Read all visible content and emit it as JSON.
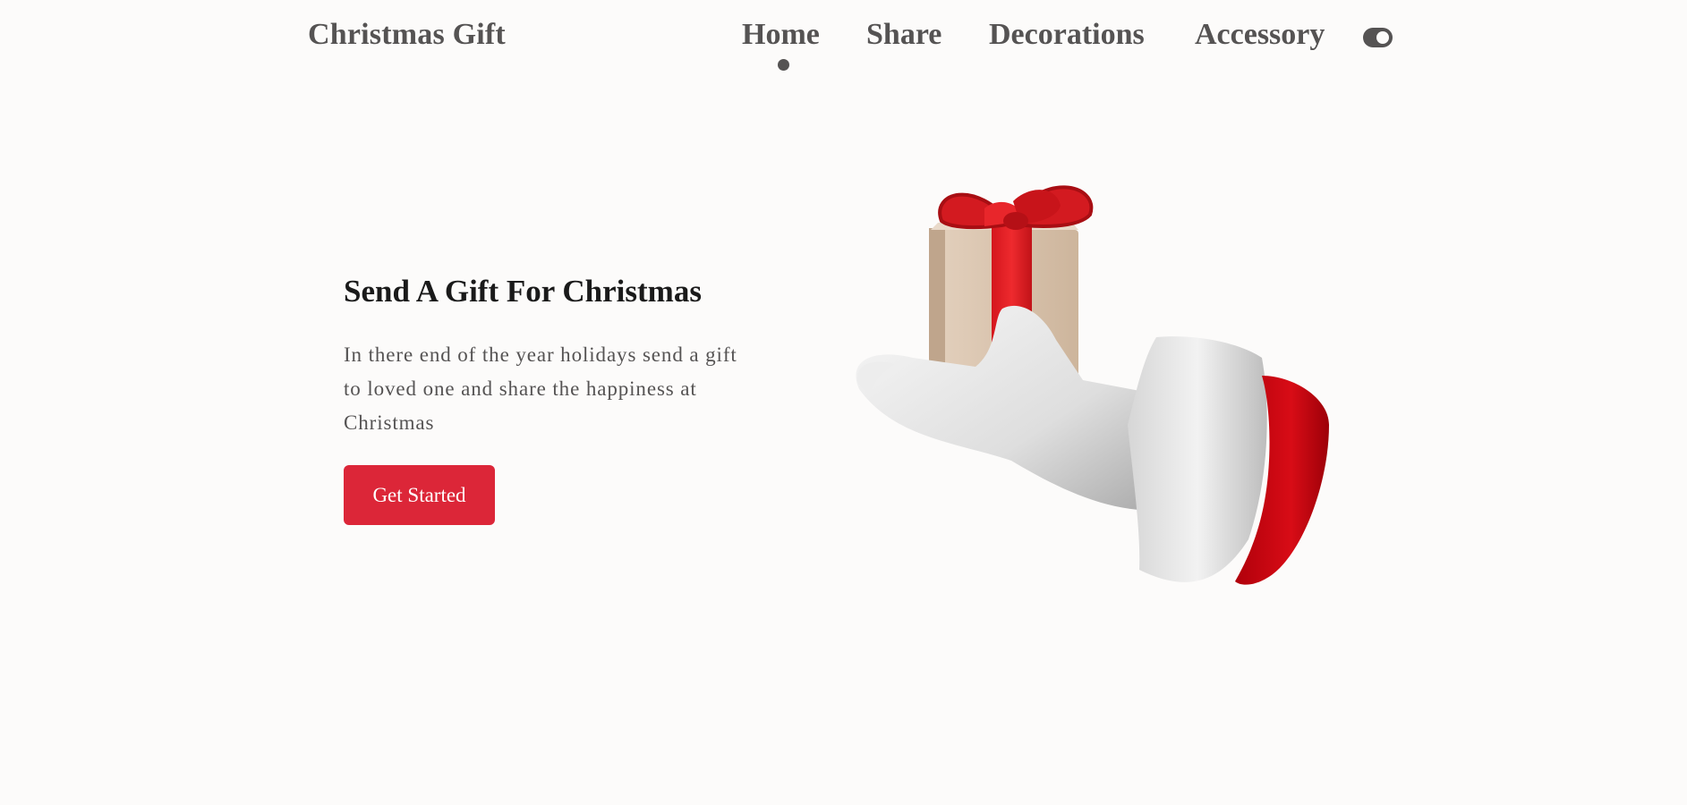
{
  "header": {
    "brand": "Christmas Gift",
    "nav": [
      "Home",
      "Share",
      "Decorations",
      "Accessory"
    ],
    "active_nav": "Home",
    "theme_toggle_icon": "toggle-icon"
  },
  "hero": {
    "title": "Send A Gift For Christmas",
    "description": "In there end of the year holidays send a gift to loved one and share the happiness at Christmas",
    "cta_label": "Get Started",
    "illustration_icon": "santa-hand-holding-gift-icon"
  },
  "colors": {
    "text_dark": "#1a1a1a",
    "text_muted": "#555353",
    "accent": "#dc2638",
    "background": "#fcfbfa"
  }
}
